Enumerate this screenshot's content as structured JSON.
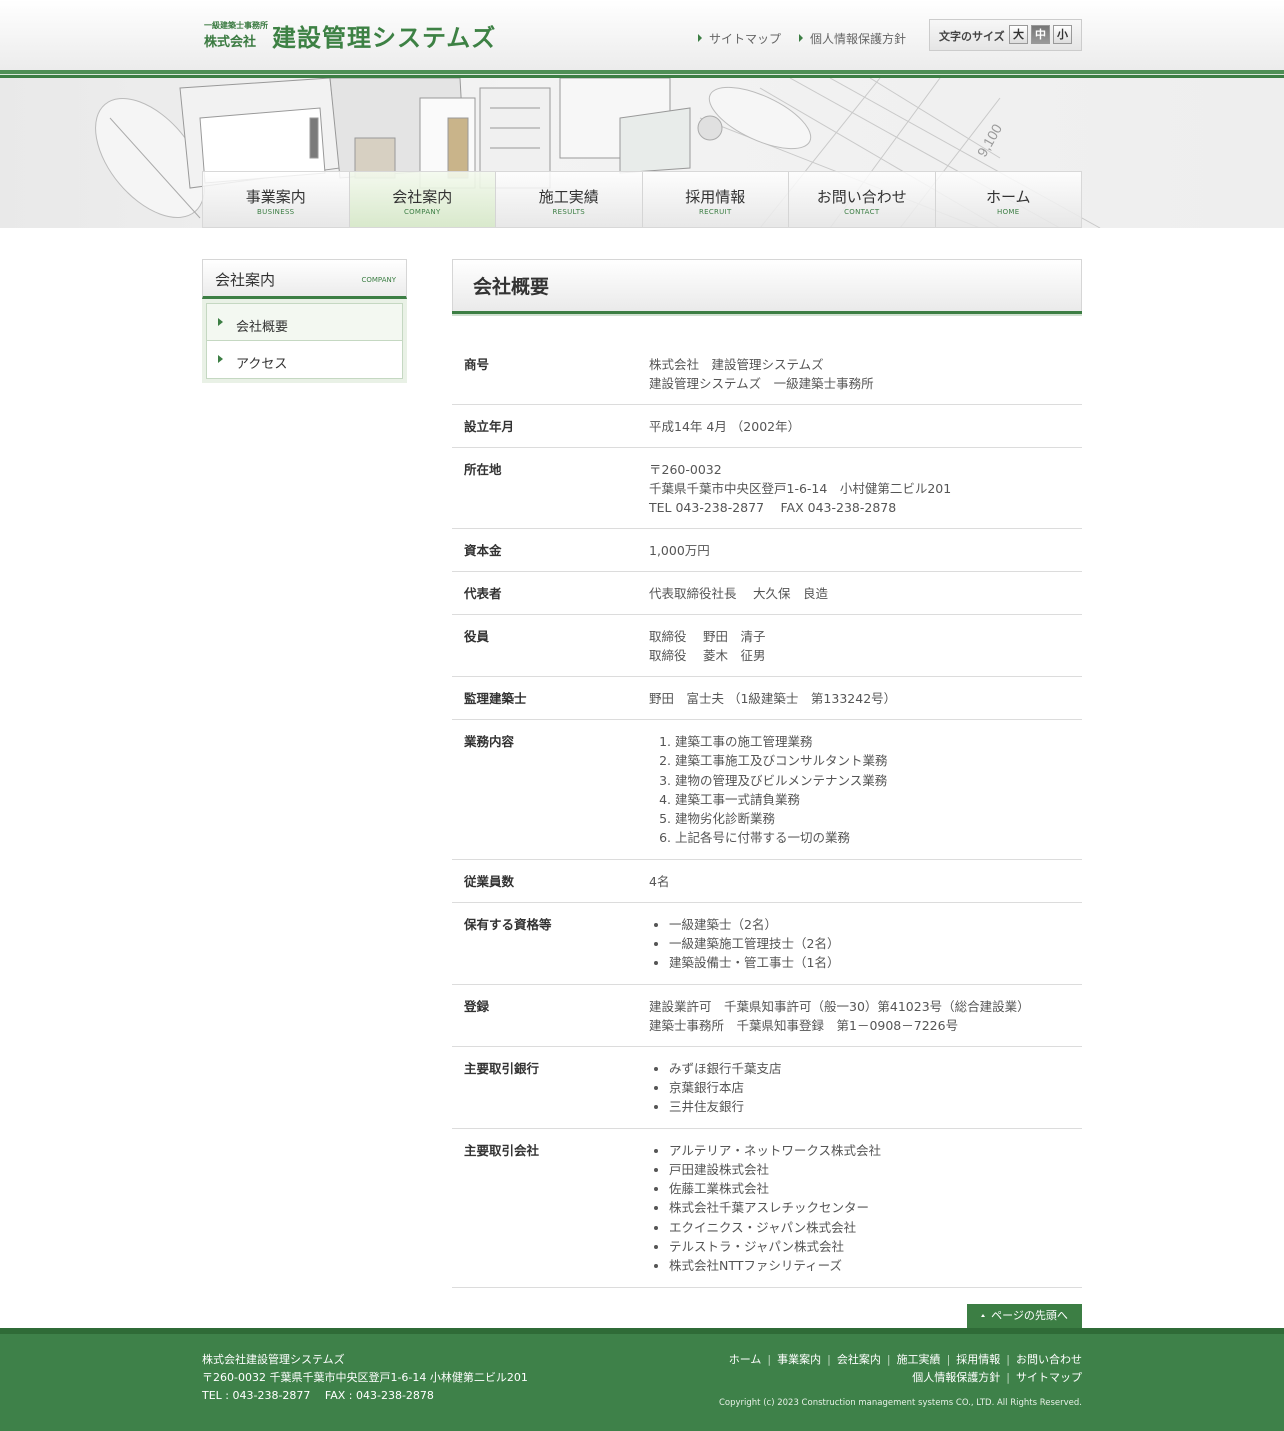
{
  "header": {
    "logo_small": "一級建築士事務所",
    "logo_company": "株式会社",
    "logo_main": "建設管理システムズ",
    "links": [
      "サイトマップ",
      "個人情報保護方針"
    ],
    "font_size_label": "文字のサイズ",
    "font_sizes": [
      "大",
      "中",
      "小"
    ],
    "font_size_selected": "中"
  },
  "gnav": [
    {
      "jp": "事業案内",
      "en": "BUSINESS"
    },
    {
      "jp": "会社案内",
      "en": "COMPANY"
    },
    {
      "jp": "施工実績",
      "en": "RESULTS"
    },
    {
      "jp": "採用情報",
      "en": "RECRUIT"
    },
    {
      "jp": "お問い合わせ",
      "en": "CONTACT"
    },
    {
      "jp": "ホーム",
      "en": "HOME"
    }
  ],
  "side": {
    "title": "会社案内",
    "title_en": "COMPANY",
    "items": [
      "会社概要",
      "アクセス"
    ]
  },
  "main": {
    "title": "会社概要",
    "rows": [
      {
        "label": "商号",
        "lines": [
          "株式会社　建設管理システムズ",
          "建設管理システムズ　一級建築士事務所"
        ]
      },
      {
        "label": "設立年月",
        "lines": [
          "平成14年 4月 （2002年）"
        ]
      },
      {
        "label": "所在地",
        "lines": [
          "〒260-0032",
          "千葉県千葉市中央区登戸1-6-14　小村健第二ビル201",
          "TEL 043-238-2877　 FAX 043-238-2878"
        ]
      },
      {
        "label": "資本金",
        "lines": [
          "1,000万円"
        ]
      },
      {
        "label": "代表者",
        "lines": [
          "代表取締役社長　 大久保　良造"
        ]
      },
      {
        "label": "役員",
        "lines": [
          "取締役　 野田　清子",
          "取締役　 菱木　征男"
        ]
      },
      {
        "label": "監理建築士",
        "lines": [
          "野田　富士夫 （1級建築士　第133242号）"
        ]
      },
      {
        "label": "業務内容",
        "ordered": [
          "建築工事の施工管理業務",
          "建築工事施工及びコンサルタント業務",
          "建物の管理及びビルメンテナンス業務",
          "建築工事一式請負業務",
          "建物劣化診断業務",
          "上記各号に付帯する一切の業務"
        ]
      },
      {
        "label": "従業員数",
        "lines": [
          "4名"
        ]
      },
      {
        "label": "保有する資格等",
        "bullets": [
          "一級建築士（2名）",
          "一級建築施工管理技士（2名）",
          "建築設備士・管工事士（1名）"
        ]
      },
      {
        "label": "登録",
        "lines": [
          "建設業許可　千葉県知事許可（般一30）第41023号（総合建設業）",
          "建築士事務所　千葉県知事登録　第1－0908－7226号"
        ]
      },
      {
        "label": "主要取引銀行",
        "bullets": [
          "みずほ銀行千葉支店",
          "京葉銀行本店",
          "三井住友銀行"
        ]
      },
      {
        "label": "主要取引会社",
        "bullets": [
          "アルテリア・ネットワークス株式会社",
          "戸田建設株式会社",
          "佐藤工業株式会社",
          "株式会社千葉アスレチックセンター",
          "エクイニクス・ジャパン株式会社",
          "テルストラ・ジャパン株式会社",
          "株式会社NTTファシリティーズ"
        ]
      }
    ]
  },
  "pagetop": "ページの先頭へ",
  "footer": {
    "company": "株式会社建設管理システムズ",
    "address": "〒260-0032 千葉県千葉市中央区登戸1-6-14 小林健第二ビル201",
    "tel_fax": "TEL : 043-238-2877　 FAX : 043-238-2878",
    "nav_row1": [
      "ホーム",
      "事業案内",
      "会社案内",
      "施工実績",
      "採用情報",
      "お問い合わせ"
    ],
    "nav_row2": [
      "個人情報保護方針",
      "サイトマップ"
    ],
    "copyright": "Copyright (c) 2023 Construction management systems CO., LTD. All Rights Reserved."
  },
  "colors": {
    "brand_green": "#3c7e44",
    "footer_green": "#3e8149"
  }
}
